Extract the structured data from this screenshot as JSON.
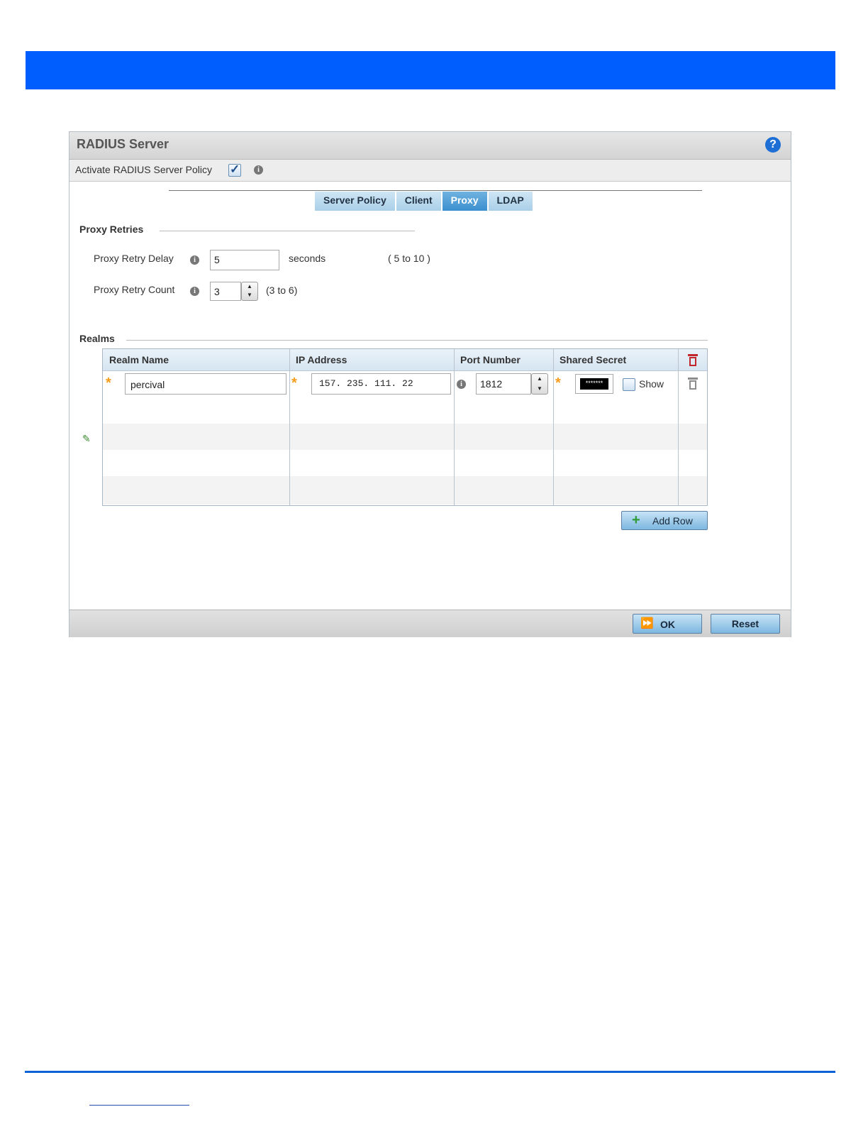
{
  "panel": {
    "title": "RADIUS Server",
    "help": "?",
    "activate_label": "Activate RADIUS Server Policy",
    "activate_checked": true
  },
  "tabs": [
    {
      "label": "Server Policy",
      "active": false
    },
    {
      "label": "Client",
      "active": false
    },
    {
      "label": "Proxy",
      "active": true
    },
    {
      "label": "LDAP",
      "active": false
    }
  ],
  "proxy_retries": {
    "title": "Proxy Retries",
    "delay_label": "Proxy Retry Delay",
    "delay_value": "5",
    "delay_unit": "seconds",
    "delay_range": "( 5 to 10 )",
    "count_label": "Proxy Retry Count",
    "count_value": "3",
    "count_range": "(3 to 6)"
  },
  "realms": {
    "title": "Realms",
    "columns": [
      "Realm Name",
      "IP Address",
      "Port Number",
      "Shared Secret"
    ],
    "rows": [
      {
        "realm_name": "percival",
        "ip_address": "157. 235. 111.  22",
        "port": "1812",
        "secret": "*******",
        "show_label": "Show",
        "show_checked": false
      }
    ],
    "add_row_label": "Add Row"
  },
  "footer": {
    "ok_label": "OK",
    "reset_label": "Reset"
  },
  "colors": {
    "header_bar": "#005eff",
    "tab_active": "#3b8fcf",
    "required_star": "#f59d1b",
    "delete_red": "#c0282d"
  }
}
